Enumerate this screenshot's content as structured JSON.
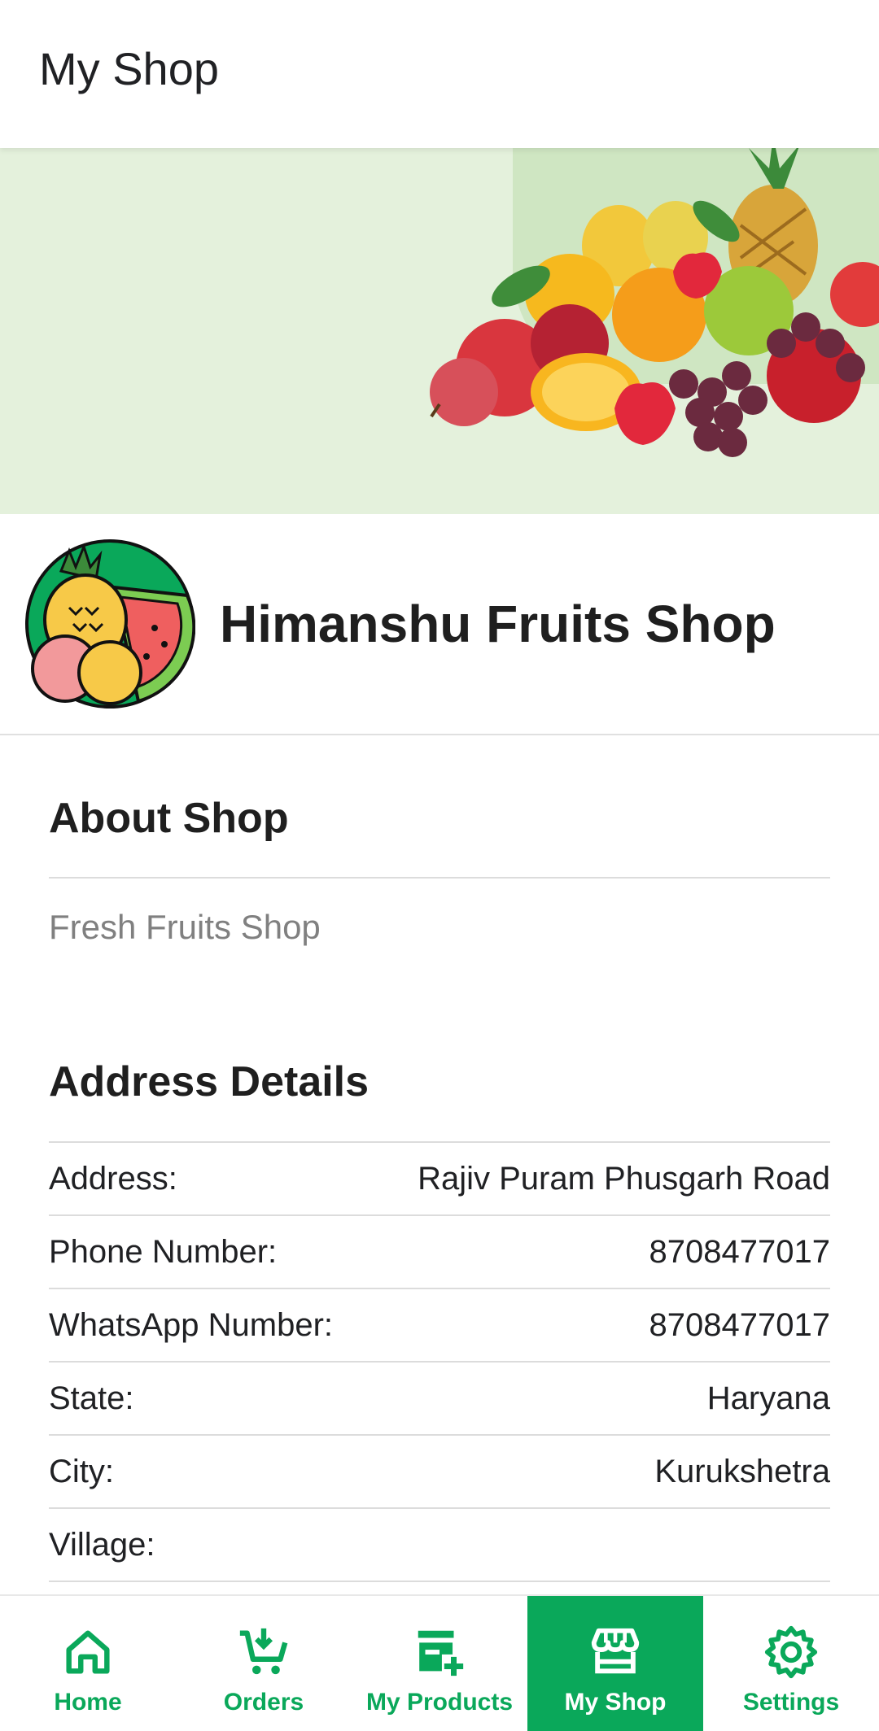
{
  "appbar": {
    "title": "My Shop"
  },
  "shop": {
    "name": "Himanshu Fruits Shop"
  },
  "about": {
    "heading": "About Shop",
    "text": "Fresh Fruits Shop"
  },
  "address": {
    "heading": "Address Details",
    "rows": [
      {
        "label": "Address:",
        "value": "Rajiv Puram Phusgarh Road"
      },
      {
        "label": "Phone Number:",
        "value": "8708477017"
      },
      {
        "label": "WhatsApp Number:",
        "value": "8708477017"
      },
      {
        "label": "State:",
        "value": "Haryana"
      },
      {
        "label": "City:",
        "value": "Kurukshetra"
      },
      {
        "label": "Village:",
        "value": ""
      }
    ]
  },
  "nav": {
    "items": [
      {
        "label": "Home",
        "icon": "home-icon"
      },
      {
        "label": "Orders",
        "icon": "cart-download-icon"
      },
      {
        "label": "My Products",
        "icon": "add-product-icon"
      },
      {
        "label": "My Shop",
        "icon": "store-icon",
        "active": true
      },
      {
        "label": "Settings",
        "icon": "gear-icon"
      }
    ]
  },
  "colors": {
    "accent": "#0aa85a",
    "banner_bg": "#e4f1dc"
  }
}
